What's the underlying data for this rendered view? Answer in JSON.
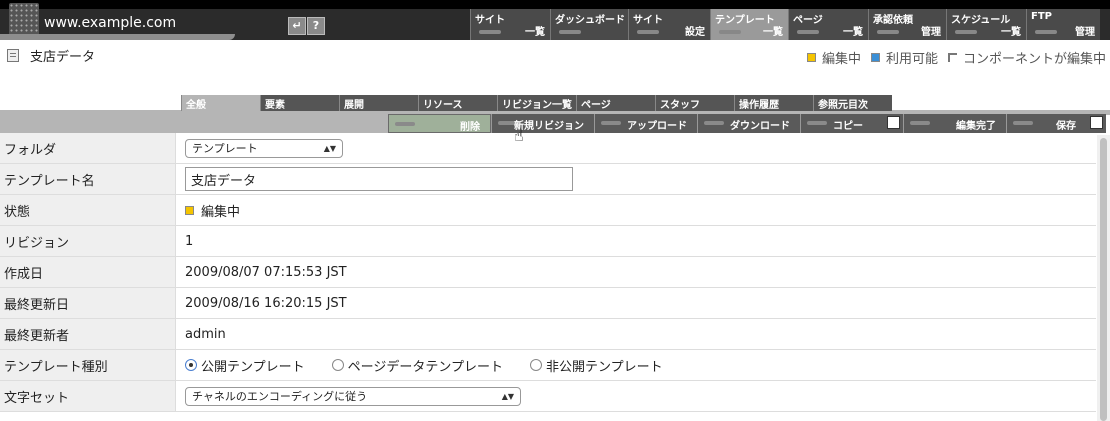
{
  "header": {
    "site": "www.example.com",
    "nav": [
      {
        "l1": "サイト",
        "l2": "一覧"
      },
      {
        "l1": "ダッシュボード",
        "l2": ""
      },
      {
        "l1": "サイト",
        "l2": "設定"
      },
      {
        "l1": "テンプレート",
        "l2": "一覧",
        "active": true
      },
      {
        "l1": "ページ",
        "l2": "一覧"
      },
      {
        "l1": "承認依頼",
        "l2": "管理"
      },
      {
        "l1": "スケジュール",
        "l2": "一覧"
      },
      {
        "l1": "FTP",
        "l2": "管理"
      }
    ]
  },
  "page": {
    "title": "支店データ"
  },
  "legend": {
    "editing": "編集中",
    "available": "利用可能",
    "component_editing": "コンポーネントが編集中",
    "editing_color": "#f5c400",
    "available_color": "#3a8fd6"
  },
  "tabs": [
    "全般",
    "要素",
    "展開",
    "リソース",
    "リビジョン一覧",
    "ページ",
    "スタッフ",
    "操作履歴",
    "参照元目次"
  ],
  "actions": [
    "削除",
    "新規リビジョン",
    "アップロード",
    "ダウンロード",
    "コピー",
    "編集完了",
    "保存"
  ],
  "fields": {
    "folder": {
      "label": "フォルダ",
      "value": "テンプレート"
    },
    "name": {
      "label": "テンプレート名",
      "value": "支店データ"
    },
    "status": {
      "label": "状態",
      "value": "編集中"
    },
    "revision": {
      "label": "リビジョン",
      "value": "1"
    },
    "created": {
      "label": "作成日",
      "value": "2009/08/07 07:15:53 JST"
    },
    "updated": {
      "label": "最終更新日",
      "value": "2009/08/16 16:20:15 JST"
    },
    "updater": {
      "label": "最終更新者",
      "value": "admin"
    },
    "type": {
      "label": "テンプレート種別",
      "options": [
        "公開テンプレート",
        "ページデータテンプレート",
        "非公開テンプレート"
      ],
      "selected": "公開テンプレート"
    },
    "charset": {
      "label": "文字セット",
      "value": "チャネルのエンコーディングに従う"
    }
  }
}
